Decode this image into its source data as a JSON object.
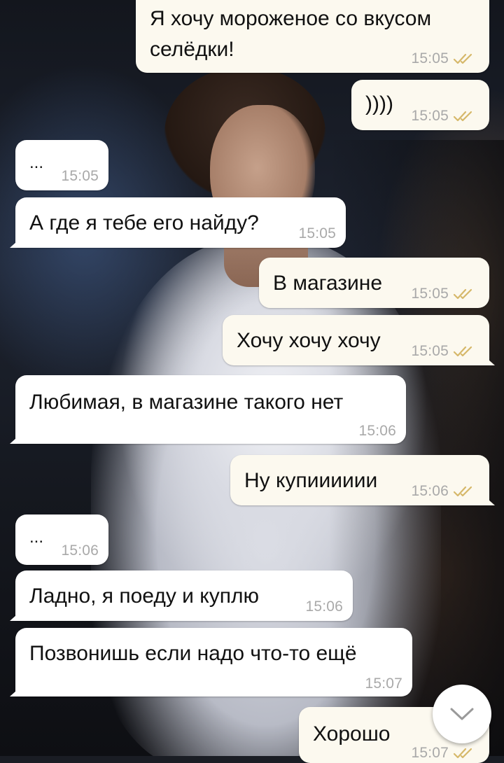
{
  "theme": {
    "outgoing_bubble": "#fcf9ef",
    "incoming_bubble": "#ffffff",
    "time_color": "#a9a9a9",
    "tick_color": "#d6b86a"
  },
  "messages": [
    {
      "dir": "out",
      "text": "Я хочу мороженое со вкусом",
      "text2": "селёдки!",
      "time": "15:05",
      "read": true
    },
    {
      "dir": "out",
      "text": "))))",
      "time": "15:05",
      "read": true
    },
    {
      "dir": "in",
      "text": "...",
      "time": "15:05"
    },
    {
      "dir": "in",
      "text": "А где я тебе его найду?",
      "time": "15:05"
    },
    {
      "dir": "out",
      "text": "В магазине",
      "time": "15:05",
      "read": true
    },
    {
      "dir": "out",
      "text": "Хочу хочу хочу",
      "time": "15:05",
      "read": true
    },
    {
      "dir": "in",
      "text": "Любимая, в магазине такого нет",
      "time": "15:06"
    },
    {
      "dir": "out",
      "text": "Ну купииииии",
      "time": "15:06",
      "read": true
    },
    {
      "dir": "in",
      "text": "...",
      "time": "15:06"
    },
    {
      "dir": "in",
      "text": "Ладно, я поеду и куплю",
      "time": "15:06"
    },
    {
      "dir": "in",
      "text": "Позвонишь если надо что-то ещё",
      "time": "15:07"
    },
    {
      "dir": "out",
      "text": "Хорошо",
      "time": "15:07",
      "read": true
    }
  ],
  "scroll_button": {
    "icon": "chevron-down-icon"
  }
}
